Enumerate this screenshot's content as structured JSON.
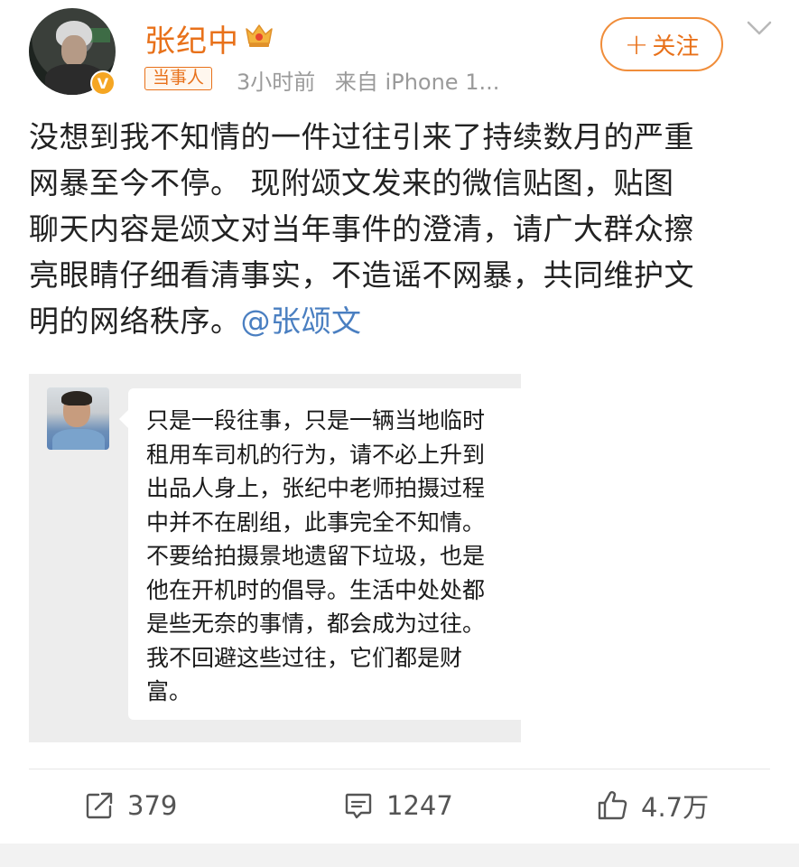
{
  "user": {
    "name": "张纪中",
    "tag": "当事人",
    "time": "3小时前",
    "source": "来自 iPhone 1..."
  },
  "follow": {
    "label": "关注"
  },
  "post": {
    "lines": [
      "没想到我不知情的一件过往引来了持续数月的严重",
      "网暴至今不停。 现附颂文发来的微信贴图，贴图",
      "聊天内容是颂文对当年事件的澄清，请广大群众擦",
      "亮眼睛仔细看清事实，不造谣不网暴，共同维护文"
    ],
    "last_line": "明的网络秩序。",
    "mention": "@张颂文"
  },
  "chat_image": {
    "lines": [
      "只是一段往事，只是一辆当地临时",
      "租用车司机的行为，请不必上升到",
      "出品人身上，张纪中老师拍摄过程",
      "中并不在剧组，此事完全不知情。",
      "不要给拍摄景地遗留下垃圾，也是",
      "他在开机时的倡导。生活中处处都",
      "是些无奈的事情，都会成为过往。",
      "我不回避这些过往，它们都是财",
      "富。"
    ]
  },
  "actions": {
    "repost_count": "379",
    "comment_count": "1247",
    "like_count": "4.7万"
  },
  "colors": {
    "accent": "#e8711a",
    "mention": "#4a7fc1",
    "verified": "#f5a623"
  },
  "icons": [
    "crown-icon",
    "verified-icon",
    "chevron-down-icon",
    "repost-icon",
    "comment-icon",
    "like-icon"
  ]
}
